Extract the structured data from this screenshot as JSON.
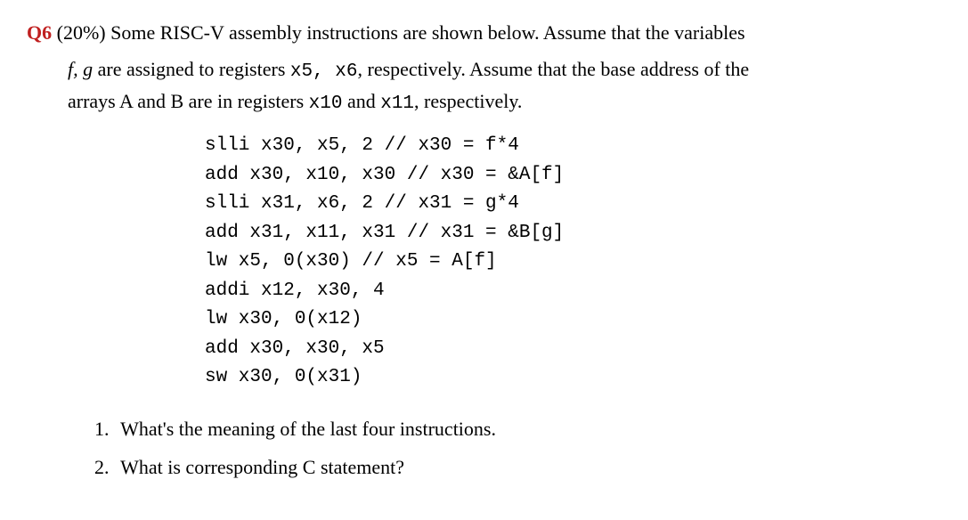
{
  "question": {
    "label": "Q6",
    "percent": "(20%)",
    "intro_part1": " Some RISC-V assembly instructions are shown below.  Assume that the variables",
    "intro_vars": "f, g",
    "intro_part2": " are assigned to registers ",
    "reg1": "x5,  x6",
    "intro_part3": ", respectively. Assume that the base address of the",
    "intro_part4": "arrays A and B are in registers ",
    "reg2": "x10",
    "intro_and": " and ",
    "reg3": "x11",
    "intro_part5": ", respectively."
  },
  "code": {
    "line1": "slli x30, x5, 2 // x30 = f*4",
    "line2": "add x30, x10, x30 // x30 = &A[f]",
    "line3": "slli x31, x6, 2 // x31 = g*4",
    "line4": "add x31, x11, x31 // x31 = &B[g]",
    "line5": "lw x5, 0(x30) // x5 = A[f]",
    "line6": "addi x12, x30, 4",
    "line7": "lw x30, 0(x12)",
    "line8": "add x30, x30, x5",
    "line9": "sw x30, 0(x31)"
  },
  "subs": {
    "n1": "1.",
    "t1": "What's the meaning of the last four instructions.",
    "n2": "2.",
    "t2": "What is corresponding C statement?"
  }
}
